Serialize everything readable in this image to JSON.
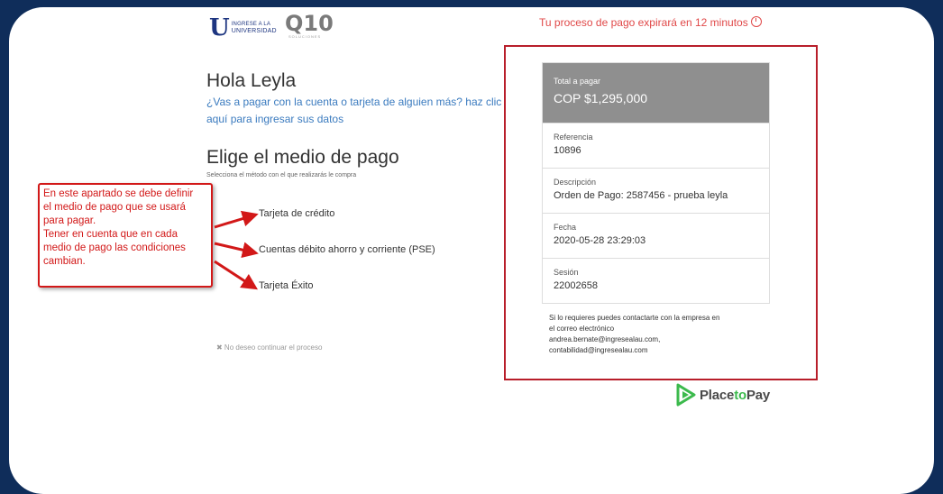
{
  "header": {
    "logo_univ_letter": "U",
    "logo_univ_text_1": "INGRESE A LA",
    "logo_univ_text_2": "UNIVERSIDAD",
    "logo_q10": "Q10",
    "logo_q10_sub": "SOLUCIONES",
    "timer_text": "Tu proceso de pago expirará en 12 minutos"
  },
  "main": {
    "greeting": "Hola Leyla",
    "pay_other_link": "¿Vas a pagar con la cuenta o tarjeta de alguien más? haz clic aquí para ingresar sus datos",
    "choose_title": "Elige el medio de pago",
    "choose_subtitle": "Selecciona el método con el que realizarás le compra",
    "methods": [
      "Tarjeta de crédito",
      "Cuentas débito ahorro y corriente (PSE)",
      "Tarjeta Éxito"
    ],
    "cancel_text": "✖ No deseo continuar el proceso"
  },
  "annotation": {
    "lines": [
      "En este apartado se debe definir",
      "el medio de pago que se usará",
      "para pagar.",
      "Tener en cuenta que en cada",
      "medio de pago las condiciones",
      "cambian."
    ]
  },
  "summary": {
    "total_label": "Total a pagar",
    "total_value": "COP $1,295,000",
    "rows": [
      {
        "label": "Referencia",
        "value": "10896"
      },
      {
        "label": "Descripción",
        "value": "Orden de Pago: 2587456 - prueba leyla"
      },
      {
        "label": "Fecha",
        "value": "2020-05-28 23:29:03"
      },
      {
        "label": "Sesión",
        "value": "22002658"
      }
    ],
    "contact_line1": "Si lo requieres puedes contactarte con la empresa en",
    "contact_line2": "el correo electrónico",
    "email1": "andrea.bernate@ingresealau.com,",
    "email2": "contabilidad@ingresealau.com"
  },
  "footer": {
    "brand_part1": "Place",
    "brand_part2": "to",
    "brand_part3": "Pay"
  },
  "colors": {
    "background": "#0f2d5a",
    "accent_red": "#d21818",
    "link_blue": "#3b7bbf",
    "total_bg": "#8f8f8f",
    "brand_green": "#3cba4d"
  }
}
